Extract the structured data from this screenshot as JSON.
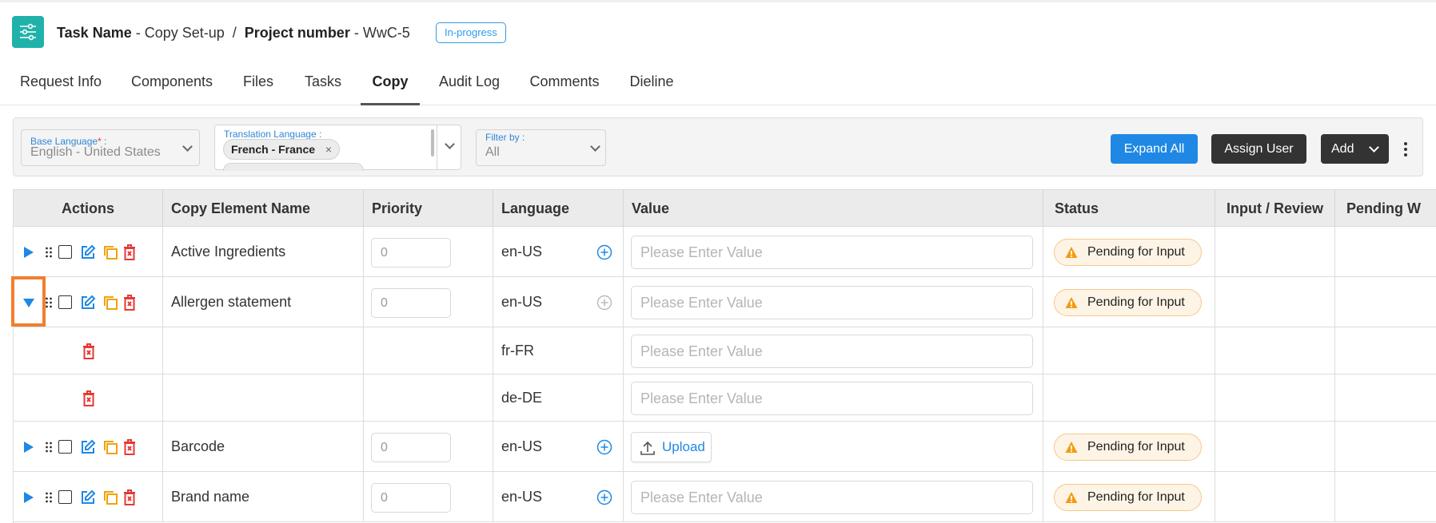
{
  "header": {
    "task_label": "Task Name",
    "task_value": " - Copy Set-up",
    "separator": "  /  ",
    "project_label": "Project number",
    "project_value": " - WwC-5",
    "status": "In-progress",
    "accent_color": "#20b2aa"
  },
  "tabs": [
    "Request Info",
    "Components",
    "Files",
    "Tasks",
    "Copy",
    "Audit Log",
    "Comments",
    "Dieline"
  ],
  "active_tab": "Copy",
  "filters": {
    "base_language": {
      "label": "Base Language",
      "required_mark": "*",
      "label_suffix": " :",
      "value": "English - United States"
    },
    "translation_language": {
      "label": "Translation Language :",
      "chip": "French - France",
      "chip_remove": "×"
    },
    "filter_by": {
      "label": "Filter by :",
      "value": "All"
    }
  },
  "buttons": {
    "expand_all": "Expand All",
    "assign_user": "Assign User",
    "add": "Add"
  },
  "table": {
    "headers": [
      "Actions",
      "Copy Element Name",
      "Priority",
      "Language",
      "Value",
      "Status",
      "Input / Review",
      "Pending W"
    ],
    "value_placeholder": "Please Enter Value",
    "upload_label": "Upload",
    "status_color": "#f39c12",
    "rows": [
      {
        "type": "main",
        "name": "Active Ingredients",
        "priority": "0",
        "language": "en-US",
        "value_kind": "input",
        "status": "Pending for Input",
        "expanded": false,
        "add_enabled": true
      },
      {
        "type": "main",
        "name": "Allergen statement",
        "priority": "0",
        "language": "en-US",
        "value_kind": "input",
        "status": "Pending for Input",
        "expanded": true,
        "add_enabled": false
      },
      {
        "type": "sub",
        "language": "fr-FR",
        "value_kind": "input"
      },
      {
        "type": "sub",
        "language": "de-DE",
        "value_kind": "input"
      },
      {
        "type": "main",
        "name": "Barcode",
        "priority": "0",
        "language": "en-US",
        "value_kind": "upload",
        "status": "Pending for Input",
        "expanded": false,
        "add_enabled": true
      },
      {
        "type": "main",
        "name": "Brand name",
        "priority": "0",
        "language": "en-US",
        "value_kind": "input",
        "status": "Pending for Input",
        "expanded": false,
        "add_enabled": true
      }
    ]
  }
}
